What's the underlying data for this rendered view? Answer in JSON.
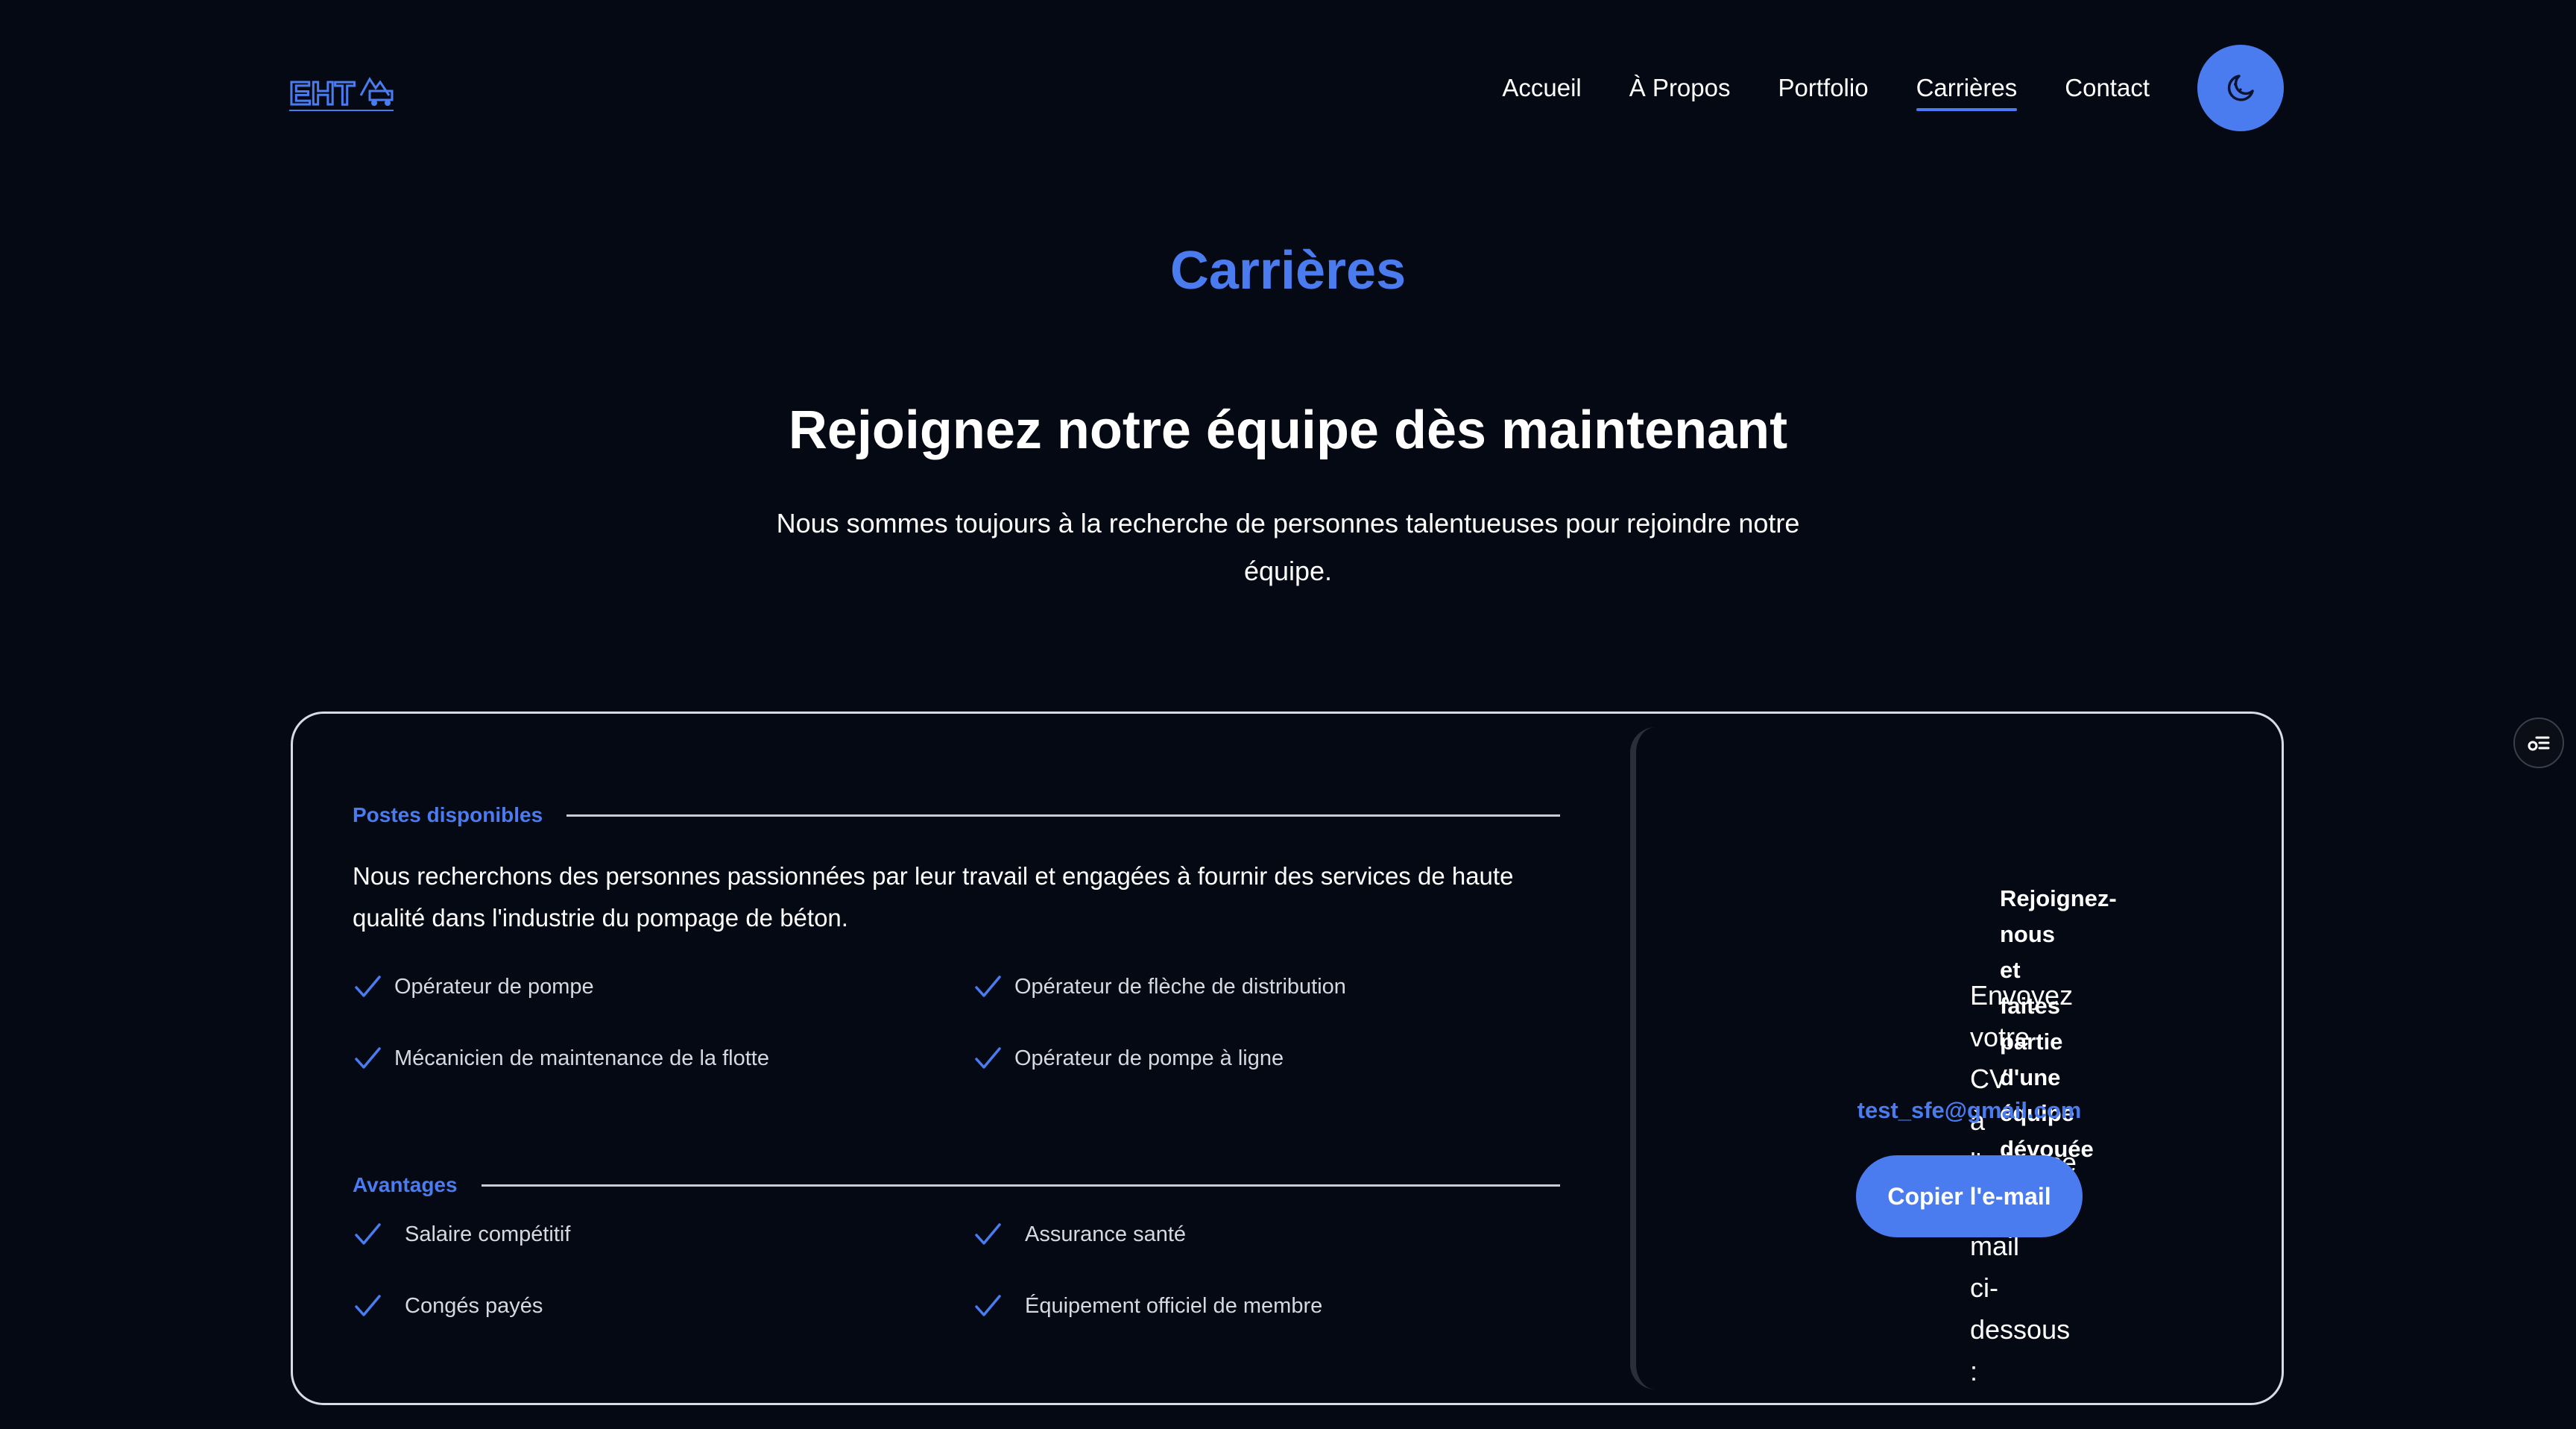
{
  "header": {
    "logo_text": "EHT",
    "nav": [
      {
        "label": "Accueil"
      },
      {
        "label": "À Propos"
      },
      {
        "label": "Portfolio"
      },
      {
        "label": "Carrières",
        "active": true
      },
      {
        "label": "Contact"
      }
    ],
    "theme_toggle_icon": "moon-icon"
  },
  "hero": {
    "section_title": "Carrières",
    "headline": "Rejoignez notre équipe dès maintenant",
    "intro": "Nous sommes toujours à la recherche de personnes talentueuses pour rejoindre notre équipe."
  },
  "positions": {
    "heading": "Postes disponibles",
    "description": "Nous recherchons des personnes passionnées par leur travail et engagées à fournir des services de haute qualité dans l'industrie du pompage de béton.",
    "items": [
      "Opérateur de pompe",
      "Opérateur de flèche de distribution",
      "Mécanicien de maintenance de la flotte",
      "Opérateur de pompe à ligne"
    ]
  },
  "benefits": {
    "heading": "Avantages",
    "items": [
      "Salaire compétitif",
      "Assurance santé",
      "Congés payés",
      "Équipement officiel de membre"
    ]
  },
  "apply": {
    "title": "Rejoignez-nous et faites partie d'une équipe dévouée !",
    "instructions": "Envoyez votre CV à l'adresse e-mail ci-dessous :",
    "email": "test_sfe@gmail.com",
    "copy_button": "Copier l'e-mail"
  },
  "colors": {
    "background": "#050914",
    "accent": "#4a7cf0",
    "text": "#ffffff",
    "border": "#d8dbe3"
  },
  "icons": {
    "check": "check-icon",
    "side_widget": "toggle-list-icon"
  }
}
